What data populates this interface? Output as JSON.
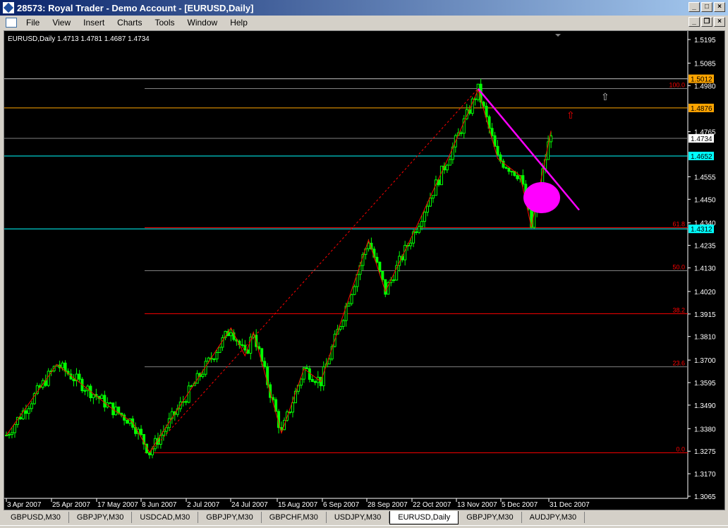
{
  "window": {
    "title": "28573: Royal Trader - Demo Account - [EURUSD,Daily]",
    "min": "_",
    "max": "□",
    "close": "×",
    "restore": "❐"
  },
  "menu": [
    "File",
    "View",
    "Insert",
    "Charts",
    "Tools",
    "Window",
    "Help"
  ],
  "chart": {
    "info": "EURUSD,Daily  1.4713 1.4781 1.4687 1.4734",
    "price_ticks": [
      "1.5195",
      "1.5085",
      "1.4980",
      "1.4765",
      "1.4555",
      "1.4450",
      "1.4340",
      "1.4235",
      "1.4130",
      "1.4020",
      "1.3915",
      "1.3810",
      "1.3700",
      "1.3595",
      "1.3490",
      "1.3380",
      "1.3275",
      "1.3170",
      "1.3065"
    ],
    "date_ticks": [
      "3 Apr 2007",
      "25 Apr 2007",
      "17 May 2007",
      "8 Jun 2007",
      "2 Jul 2007",
      "24 Jul 2007",
      "15 Aug 2007",
      "6 Sep 2007",
      "28 Sep 2007",
      "22 Oct 2007",
      "13 Nov 2007",
      "5 Dec 2007",
      "31 Dec 2007"
    ],
    "hlines": [
      {
        "price": 1.5012,
        "label": "1.5012",
        "line": "#c0c0c0",
        "bg": "#ffa500",
        "fg": "#000"
      },
      {
        "price": 1.4876,
        "label": "1.4876",
        "line": "#ffa500",
        "bg": "#ffa500",
        "fg": "#000"
      },
      {
        "price": 1.4734,
        "label": "1.4734",
        "line": "#808080",
        "bg": "#ffffff",
        "fg": "#000"
      },
      {
        "price": 1.4652,
        "label": "1.4652",
        "line": "#00ffff",
        "bg": "#00ffff",
        "fg": "#000"
      },
      {
        "price": 1.4312,
        "label": "1.4312",
        "line": "#00ffff",
        "bg": "#00ffff",
        "fg": "#000"
      }
    ],
    "fibo": {
      "low": 1.3268,
      "high": 1.4966,
      "color": "#ff0000",
      "levels": [
        {
          "r": 0,
          "label": "0.0"
        },
        {
          "r": 0.236,
          "label": "23.6"
        },
        {
          "r": 0.382,
          "label": "38.2"
        },
        {
          "r": 0.5,
          "label": "50.0"
        },
        {
          "r": 0.618,
          "label": "61.8"
        },
        {
          "r": 1,
          "label": "100.0"
        }
      ]
    },
    "candle_color": "#00ff00",
    "pivots": [
      [
        0,
        1.335
      ],
      [
        18,
        1.368
      ],
      [
        38,
        1.347
      ],
      [
        45,
        1.341
      ],
      [
        51,
        1.327
      ],
      [
        80,
        1.385
      ],
      [
        85,
        1.372
      ],
      [
        88,
        1.383
      ],
      [
        98,
        1.336
      ],
      [
        106,
        1.366
      ],
      [
        112,
        1.36
      ],
      [
        129,
        1.426
      ],
      [
        135,
        1.402
      ],
      [
        146,
        1.432
      ],
      [
        158,
        1.466
      ],
      [
        168,
        1.496
      ],
      [
        175,
        1.464
      ],
      [
        183,
        1.456
      ],
      [
        187,
        1.432
      ],
      [
        194,
        1.477
      ]
    ]
  },
  "tabs": [
    "GBPUSD,M30",
    "GBPJPY,M30",
    "USDCAD,M30",
    "GBPJPY,M30",
    "GBPCHF,M30",
    "USDJPY,M30",
    "EURUSD,Daily",
    "GBPJPY,M30",
    "AUDJPY,M30"
  ],
  "active_tab": 6
}
